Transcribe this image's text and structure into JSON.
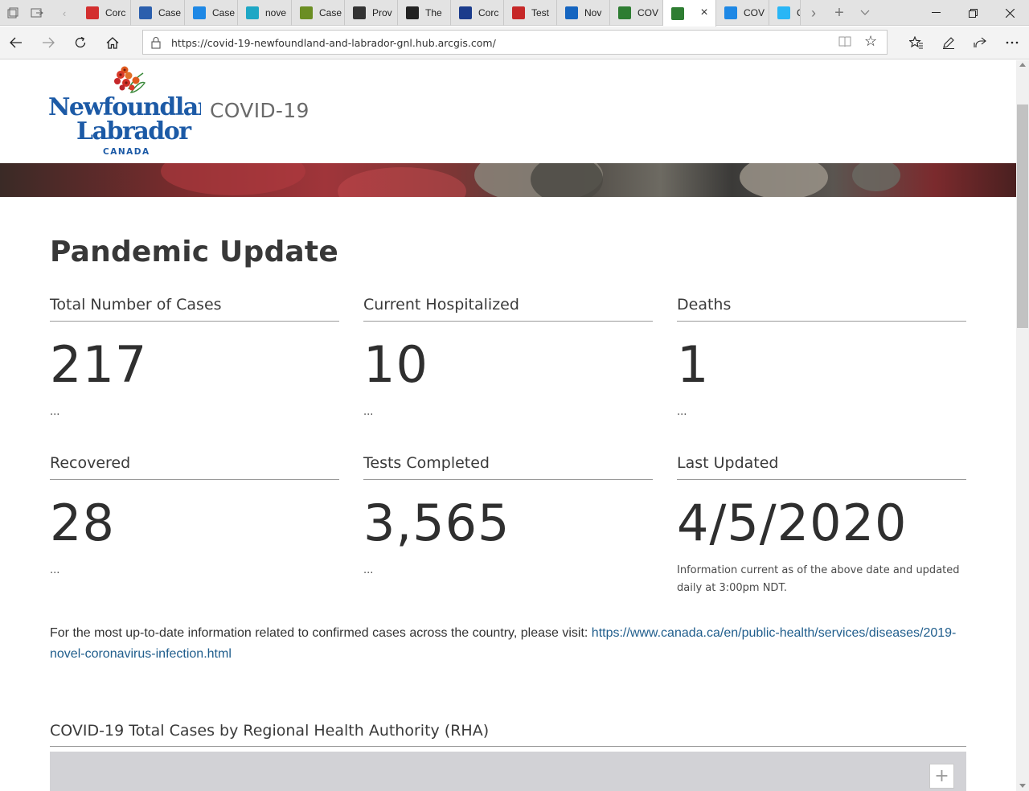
{
  "browser": {
    "tabs": [
      {
        "label": "Corc",
        "icon": "maple-leaf-icon",
        "color": "#d32f2f"
      },
      {
        "label": "Case",
        "icon": "cbc-icon",
        "color": "#2b5fad"
      },
      {
        "label": "Case",
        "icon": "chart-icon",
        "color": "#1e88e5"
      },
      {
        "label": "nove",
        "icon": "medical-cross-icon",
        "color": "#1ea7c5"
      },
      {
        "label": "Case",
        "icon": "shield-icon",
        "color": "#6b8e23"
      },
      {
        "label": "Prov",
        "icon": "bison-icon",
        "color": "#333333"
      },
      {
        "label": "The",
        "icon": "circle-logo-icon",
        "color": "#222222"
      },
      {
        "label": "Corc",
        "icon": "fleur-de-lis-icon",
        "color": "#1b3c8c"
      },
      {
        "label": "Test",
        "icon": "ab-icon",
        "color": "#c62828"
      },
      {
        "label": "Nov",
        "icon": "ns-flag-icon",
        "color": "#1565c0"
      },
      {
        "label": "COV",
        "icon": "nb-icon",
        "color": "#2e7d32"
      },
      {
        "label": "",
        "icon": "globe-icon",
        "color": "#2e7d32",
        "active": true
      },
      {
        "label": "COV",
        "icon": "arcgis-icon",
        "color": "#1e88e5"
      },
      {
        "label": "C",
        "icon": "wave-icon",
        "color": "#29b6f6"
      }
    ],
    "url": "https://covid-19-newfoundland-and-labrador-gnl.hub.arcgis.com/"
  },
  "header": {
    "logo_lines": [
      "Newfoundland",
      "Labrador",
      "CANADA"
    ],
    "site_title": "COVID-19"
  },
  "section_title": "Pandemic Update",
  "stats": [
    {
      "label": "Total Number of Cases",
      "value": "217",
      "foot": "..."
    },
    {
      "label": "Current Hospitalized",
      "value": "10",
      "foot": "..."
    },
    {
      "label": "Deaths",
      "value": "1",
      "foot": "..."
    },
    {
      "label": "Recovered",
      "value": "28",
      "foot": "..."
    },
    {
      "label": "Tests Completed",
      "value": "3,565",
      "foot": "..."
    },
    {
      "label": "Last Updated",
      "value": "4/5/2020",
      "foot": "Information current as of the above date and updated daily at 3:00pm NDT."
    }
  ],
  "info": {
    "text": "For the most up-to-date information related to confirmed cases across the country, please visit: ",
    "link": "https://www.canada.ca/en/public-health/services/diseases/2019-novel-coronavirus-infection.html"
  },
  "rha_title": "COVID-19 Total Cases by Regional Health Authority (RHA)",
  "map": {
    "zoom_in_label": "+"
  },
  "colors": {
    "link": "#1f5d8c",
    "logo_blue": "#1c5aa6",
    "heading": "#383838"
  }
}
